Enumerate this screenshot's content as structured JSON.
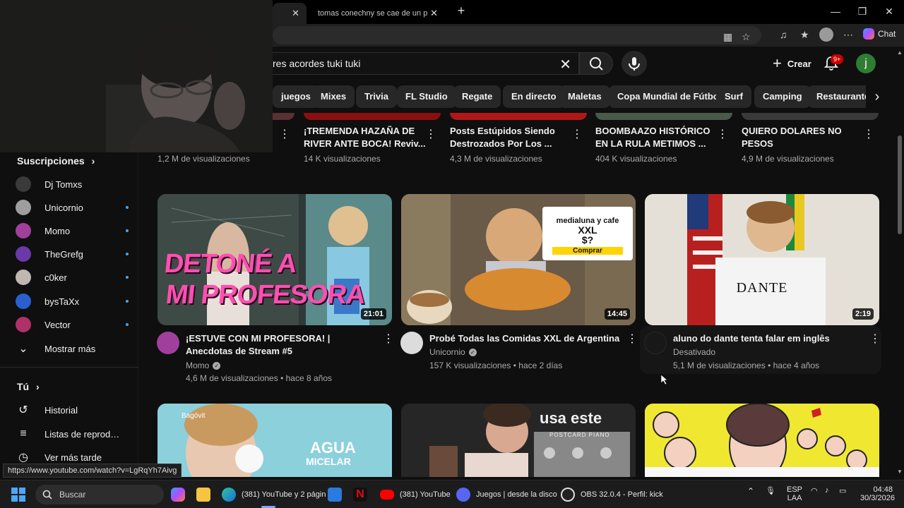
{
  "browser": {
    "tab_inactive_title": "tomas conechny se cae de un piso",
    "new_tab_icon": "plus-icon",
    "chat_label": "Chat",
    "status_url": "https://www.youtube.com/watch?v=LgRqYh7Aivg"
  },
  "header": {
    "search_query": "res acordes tuki tuki",
    "create_label": "Crear",
    "notifications_badge": "9+",
    "avatar_letter": "j"
  },
  "chips": [
    "juegos",
    "Mixes",
    "Trivia",
    "FL Studio",
    "Regate",
    "En directo",
    "Maletas",
    "Copa Mundial de Fútbol",
    "Surf",
    "Camping",
    "Restaurantes"
  ],
  "sidebar": {
    "subscriptions_title": "Suscripciones",
    "channels": [
      {
        "name": "Dj Tomxs",
        "color": "#3a3a3a",
        "dot": false
      },
      {
        "name": "Unicornio",
        "color": "#9e9e9e",
        "dot": true
      },
      {
        "name": "Momo",
        "color": "#a0409c",
        "dot": true
      },
      {
        "name": "TheGrefg",
        "color": "#6a3aa8",
        "dot": true
      },
      {
        "name": "c0ker",
        "color": "#c0b8b0",
        "dot": true
      },
      {
        "name": "bysTaXx",
        "color": "#2a5fd0",
        "dot": true
      },
      {
        "name": "Vector",
        "color": "#b0306a",
        "dot": true
      }
    ],
    "show_more": "Mostrar más",
    "you_title": "Tú",
    "you_items": [
      {
        "label": "Historial",
        "icon": "history-icon"
      },
      {
        "label": "Listas de reproducc...",
        "icon": "playlists-icon"
      },
      {
        "label": "Ver más tarde",
        "icon": "watch-later-icon"
      }
    ]
  },
  "top_row": [
    {
      "title_line1": "",
      "title_line2": "",
      "meta": "1,2 M de visualizaciones",
      "strip_color": "#5a3030"
    },
    {
      "title_line1": "¡TREMENDA HAZAÑA DE",
      "title_line2": "RIVER ANTE BOCA! Reviv...",
      "meta": "14 K visualizaciones",
      "strip_color": "#8a1010"
    },
    {
      "title_line1": "Posts Estúpidos Siendo",
      "title_line2": "Destrozados Por Los ...",
      "meta": "4,3 M de visualizaciones",
      "strip_color": "#b01818"
    },
    {
      "title_line1": "BOOMBAAZO HISTÓRICO",
      "title_line2": "EN LA RULA METIMOS ...",
      "meta": "404 K visualizaciones",
      "strip_color": "#4a5a4a"
    },
    {
      "title_line1": "QUIERO DOLARES NO",
      "title_line2": "PESOS",
      "meta": "4,9 M de visualizaciones",
      "strip_color": "#3a3a3a"
    }
  ],
  "videos": [
    {
      "title": "¡ESTUVE CON MI PROFESORA! | Anecdotas de Stream #5",
      "channel": "Momo",
      "verified": true,
      "views": "4,6 M de visualizaciones",
      "age": "hace 8 años",
      "duration": "21:01",
      "thumb_text_1": "DETONÉ A",
      "thumb_text_2": "MI PROFESORA",
      "avatar_color": "#a0409c"
    },
    {
      "title": "Probé Todas las Comidas XXL de Argentina",
      "channel": "Unicornio",
      "verified": true,
      "views": "157 K visualizaciones",
      "age": "hace 2 días",
      "duration": "14:45",
      "thumb_card_1": "medialuna y cafe",
      "thumb_card_2": "XXL",
      "thumb_card_3": "$?",
      "thumb_card_button": "Comprar",
      "avatar_color": "#dcdcdc"
    },
    {
      "title": "aluno do dante tenta falar em inglês",
      "channel": "Desativado",
      "verified": false,
      "views": "5,1 M de visualizaciones",
      "age": "hace 4 años",
      "duration": "2:19",
      "thumb_shirt": "DANTE",
      "avatar_color": "#111111"
    }
  ],
  "bottom_row": [
    {
      "brand": "Bagóvit",
      "text_1": "AGUA",
      "text_2": "MICELAR"
    },
    {
      "text_1": "usa este",
      "text_2": "POSTCARD PIANO"
    },
    {
      "text_1": ""
    }
  ],
  "taskbar": {
    "search_label": "Buscar",
    "apps": [
      {
        "label": "(381) YouTube y 2 págin",
        "icon": "edge-icon"
      },
      {
        "label": "(381) YouTube",
        "icon": "youtube-icon"
      },
      {
        "label": "Juegos | desde la disco",
        "icon": "discord-icon"
      },
      {
        "label": "OBS 32.0.4 - Perfil: kick",
        "icon": "obs-icon"
      }
    ],
    "lang_1": "ESP",
    "lang_2": "LAA",
    "time": "04:48",
    "date": "30/3/2026"
  }
}
